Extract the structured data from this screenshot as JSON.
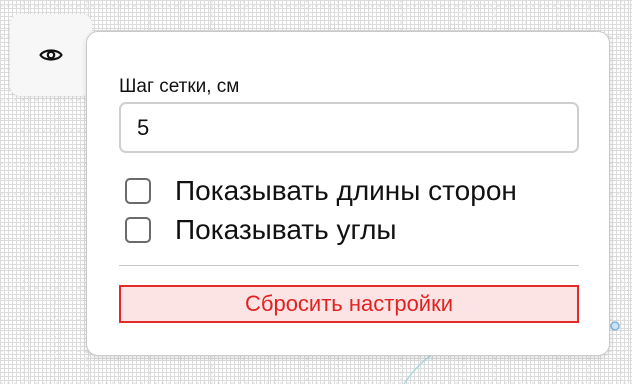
{
  "toolbar": {
    "visibility_icon": "eye-icon"
  },
  "settings_panel": {
    "grid_step_label": "Шаг сетки, см",
    "grid_step_value": "5",
    "show_side_lengths_label": "Показывать длины сторон",
    "show_side_lengths_checked": false,
    "show_angles_label": "Показывать углы",
    "show_angles_checked": false,
    "reset_label": "Сбросить настройки"
  },
  "colors": {
    "reset_text": "#e22222",
    "reset_border": "#e52a2a",
    "reset_background": "#fce4e4",
    "canvas_shape_stroke": "#a8d8df",
    "canvas_point": "#7fb3e0"
  }
}
